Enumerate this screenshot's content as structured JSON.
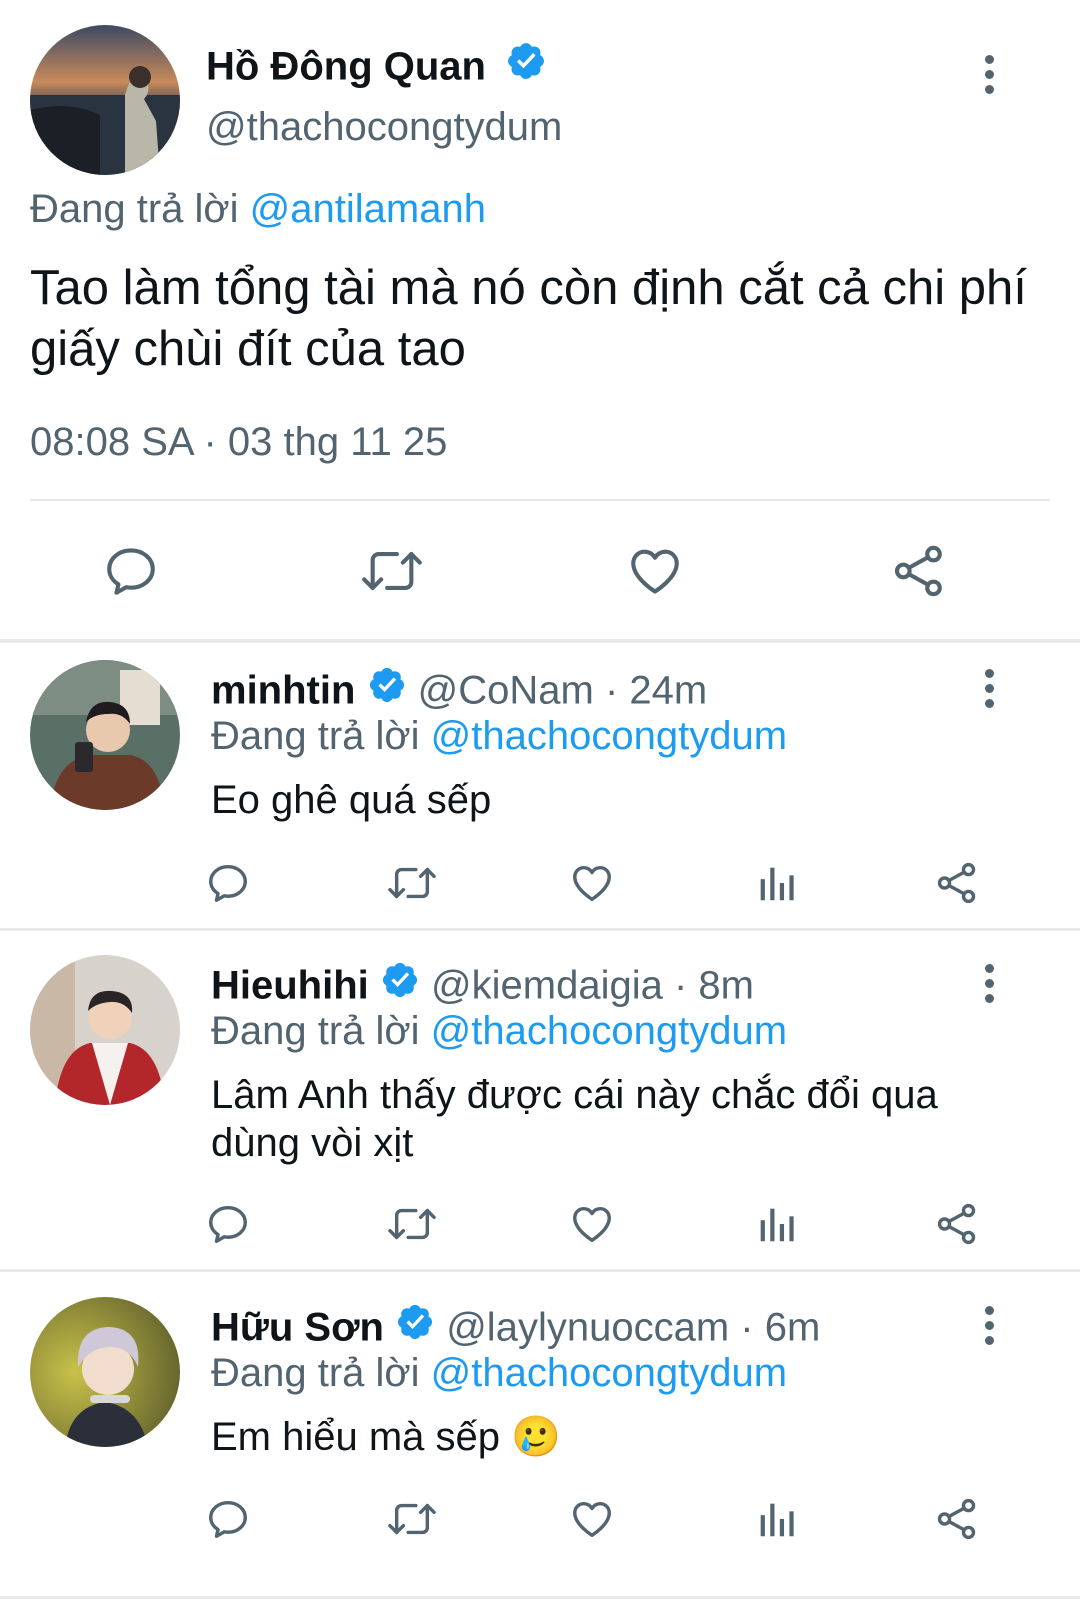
{
  "main_tweet": {
    "display_name": "Hồ Đông Quan",
    "handle": "@thachocongtydum",
    "reply_prefix": "Đang trả lời",
    "reply_to": "@antilamanh",
    "text": "Tao làm tổng tài mà nó còn định cắt cả chi phí giấy chùi đít của tao",
    "timestamp": "08:08 SA · 03 thg 11 25"
  },
  "replies": [
    {
      "display_name": "minhtin",
      "handle": "@CoNam",
      "time": "· 24m",
      "reply_prefix": "Đang trả lời",
      "reply_to": "@thachocongtydum",
      "text": "Eo ghê quá sếp"
    },
    {
      "display_name": "Hieuhihi",
      "handle": "@kiemdaigia",
      "time": "· 8m",
      "reply_prefix": "Đang trả lời",
      "reply_to": "@thachocongtydum",
      "text": "Lâm Anh thấy được cái này chắc đổi qua dùng vòi xịt"
    },
    {
      "display_name": "Hữu Sơn",
      "handle": "@laylynuoccam",
      "time": "· 6m",
      "reply_prefix": "Đang trả lời",
      "reply_to": "@thachocongtydum",
      "text": "Em hiểu mà sếp 🥲"
    }
  ],
  "colors": {
    "accent": "#1d9bf0",
    "muted_text": "#536471",
    "primary_text": "#0f1419",
    "separator": "#e7e9ec"
  },
  "icons": [
    "verified-badge-icon",
    "more-options-icon",
    "reply-icon",
    "retweet-icon",
    "like-icon",
    "views-icon",
    "share-icon"
  ]
}
